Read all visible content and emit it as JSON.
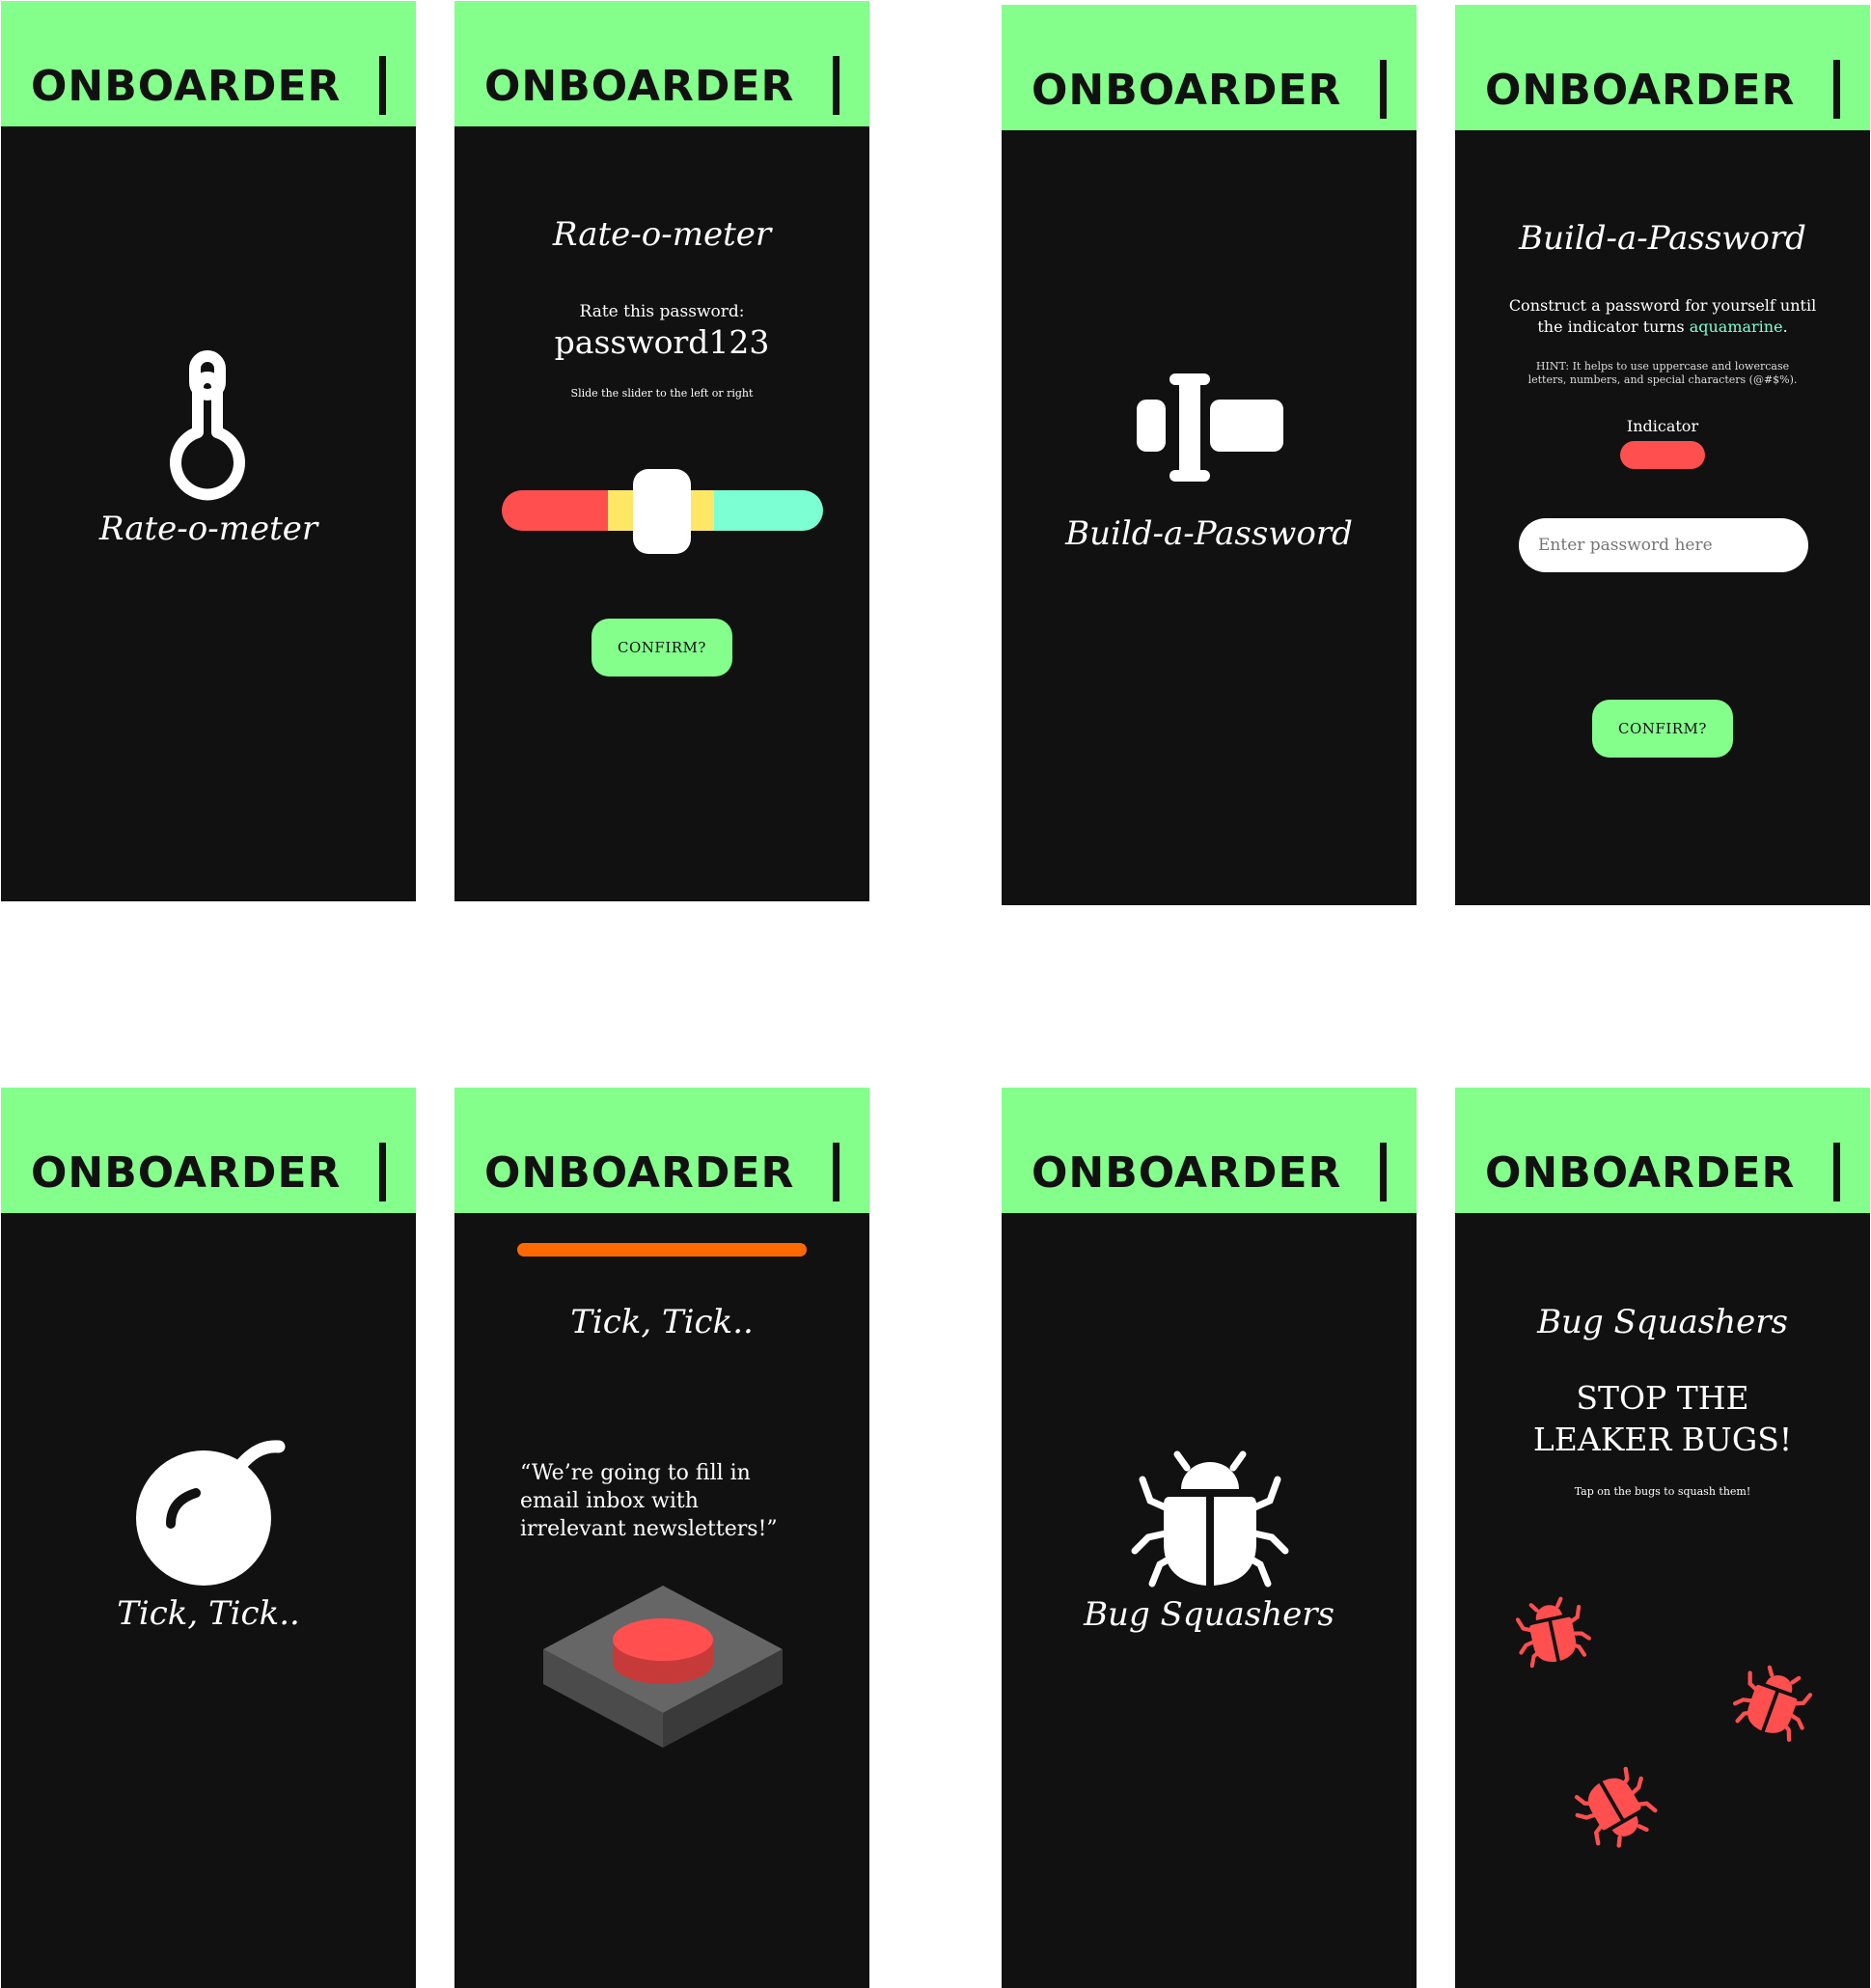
{
  "brand": {
    "logo_text": "ONBOARDER"
  },
  "colors": {
    "accent_green": "#84ff8c",
    "screen_bg": "#111111",
    "red": "#ff4f4f",
    "yellow": "#ffe766",
    "aquamarine": "#7dffd4",
    "orange": "#ff6a00"
  },
  "rate_intro": {
    "title": "Rate-o-meter",
    "icon": "thermometer-icon"
  },
  "rate_game": {
    "title": "Rate-o-meter",
    "prompt": "Rate this password:",
    "password": "password123",
    "instruction": "Slide the slider to the left or right",
    "slider_level": 0.5,
    "confirm": "CONFIRM?"
  },
  "build_intro": {
    "title": "Build-a-Password",
    "icon": "text-cursor-icon"
  },
  "build_game": {
    "title": "Build-a-Password",
    "desc_line1": "Construct a password for yourself until",
    "desc_line2_pre": "the indicator turns",
    "desc_highlight": "aquamarine",
    "desc_end": ".",
    "hint_line1": "HINT: It helps to use uppercase and lowercase",
    "hint_line2": "letters, numbers, and special characters (@#$%).",
    "indicator_label": "Indicator",
    "indicator_color": "#ff4f4f",
    "input_placeholder": "Enter password here",
    "confirm": "CONFIRM?"
  },
  "tick_intro": {
    "title": "Tick, Tick..",
    "icon": "bomb-icon"
  },
  "tick_game": {
    "title": "Tick, Tick..",
    "quote_line1": "“We’re going to fill in",
    "quote_line2": "email inbox with",
    "quote_line3": "irrelevant newsletters!”",
    "timer_level": 1.0,
    "button_icon": "big-red-button-icon"
  },
  "bug_intro": {
    "title": "Bug Squashers",
    "icon": "bug-icon"
  },
  "bug_game": {
    "title": "Bug Squashers",
    "headline_line1": "STOP THE",
    "headline_line2": "LEAKER BUGS!",
    "instruction": "Tap on the bugs to squash them!",
    "bug_icon": "bug-icon"
  }
}
